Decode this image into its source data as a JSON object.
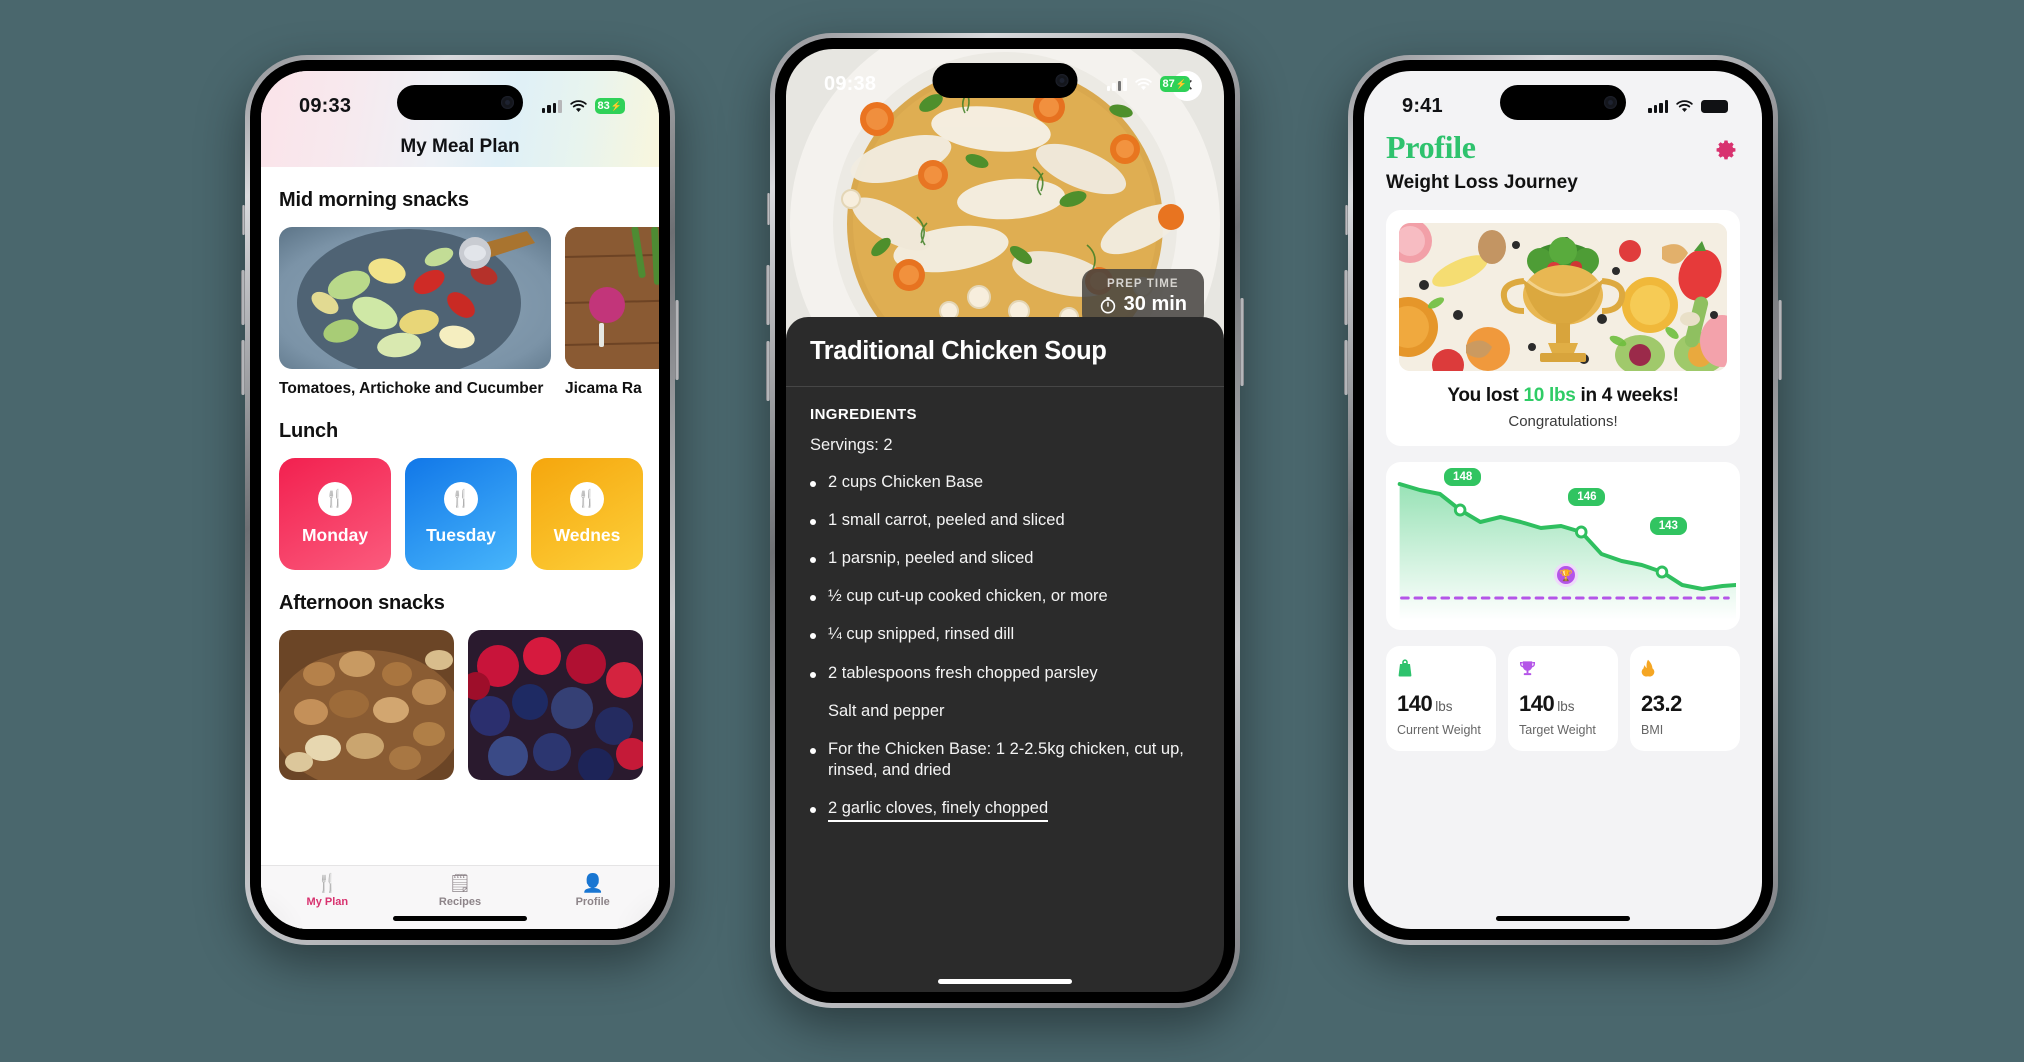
{
  "phone_meal_plan": {
    "status": {
      "time": "09:33",
      "battery_level": "83",
      "battery_charging": true,
      "signal_icon": "cellular-bars-icon",
      "wifi_icon": "wifi-icon"
    },
    "header": {
      "title": "My Meal Plan"
    },
    "sections": [
      {
        "title": "Mid morning snacks",
        "type": "snacks",
        "items": [
          {
            "label": "Tomatoes, Artichoke and Cucumber",
            "image": "cucumber-artichoke-salad-photo"
          },
          {
            "label": "Jicama Ra",
            "image": "jicama-radish-salad-photo"
          }
        ]
      },
      {
        "title": "Lunch",
        "type": "days",
        "items": [
          {
            "label": "Monday",
            "color": "#f4365e",
            "icon": "cutlery-icon"
          },
          {
            "label": "Tuesday",
            "color": "#1f8ef1",
            "icon": "cutlery-icon"
          },
          {
            "label": "Wednes",
            "color": "#f9b318",
            "icon": "cutlery-icon"
          }
        ]
      },
      {
        "title": "Afternoon snacks",
        "type": "snacks",
        "items": [
          {
            "label": "",
            "image": "mixed-nuts-photo"
          },
          {
            "label": "",
            "image": "mixed-berries-photo"
          }
        ]
      }
    ],
    "tabs": [
      {
        "label": "My Plan",
        "icon": "cutlery-icon",
        "active": true
      },
      {
        "label": "Recipes",
        "icon": "recipe-list-icon",
        "active": false
      },
      {
        "label": "Profile",
        "icon": "person-icon",
        "active": false
      }
    ],
    "active_tab_color": "#d8326f",
    "inactive_tab_color": "#9a9198"
  },
  "phone_recipe": {
    "status": {
      "time": "09:38",
      "battery_level": "87",
      "battery_charging": true,
      "signal_icon": "cellular-bars-icon",
      "wifi_icon": "wifi-icon"
    },
    "hero": {
      "image": "chicken-soup-bowl-photo",
      "close_icon": "close-icon"
    },
    "prep": {
      "label": "PREP TIME",
      "value": "30 min",
      "icon": "stopwatch-icon"
    },
    "recipe_title": "Traditional Chicken Soup",
    "ingredients_heading": "INGREDIENTS",
    "servings": "Servings: 2",
    "ingredients": [
      {
        "text": "2 cups Chicken Base",
        "bullet": true,
        "underline": false
      },
      {
        "text": "1 small carrot, peeled and sliced",
        "bullet": true,
        "underline": false
      },
      {
        "text": "1 parsnip, peeled and sliced",
        "bullet": true,
        "underline": false
      },
      {
        "text": "½ cup cut-up cooked chicken, or more",
        "bullet": true,
        "underline": false
      },
      {
        "text": "¼ cup snipped, rinsed dill",
        "bullet": true,
        "underline": false
      },
      {
        "text": "2 tablespoons fresh chopped parsley",
        "bullet": true,
        "underline": false
      },
      {
        "text": "Salt and pepper",
        "bullet": false,
        "underline": false
      },
      {
        "text": "For the Chicken Base: 1 2-2.5kg chicken, cut up, rinsed, and dried",
        "bullet": true,
        "underline": false
      },
      {
        "text": "2 garlic cloves, finely chopped",
        "bullet": true,
        "underline": true
      }
    ]
  },
  "phone_profile": {
    "status": {
      "time": "9:41",
      "battery_level": "",
      "battery_charging": false,
      "signal_icon": "cellular-bars-icon",
      "wifi_icon": "wifi-icon"
    },
    "gear_icon": "gear-icon",
    "title": "Profile",
    "title_color": "#2ec26d",
    "subtitle": "Weight Loss Journey",
    "achievement": {
      "image": "trophy-with-salad-and-fruits-photo",
      "headline_prefix": "You lost ",
      "headline_highlight": "10 lbs",
      "headline_suffix": " in 4 weeks!",
      "highlight_color": "#2fcc66",
      "congrats": "Congratulations!"
    },
    "stats": [
      {
        "icon": "weight-scale-icon",
        "icon_color": "#2ec26d",
        "value": "140",
        "unit": "lbs",
        "label": "Current Weight"
      },
      {
        "icon": "trophy-icon",
        "icon_color": "#b455e8",
        "value": "140",
        "unit": "lbs",
        "label": "Target Weight"
      },
      {
        "icon": "flame-icon",
        "icon_color": "#f5a623",
        "value": "23.2",
        "unit": "",
        "label": "BMI"
      }
    ],
    "chart_data": {
      "type": "area",
      "title": "",
      "xlabel": "",
      "ylabel": "",
      "line_color": "#2fbf5f",
      "fill_color": "#b9e9cc",
      "goal_line_color": "#b455e8",
      "goal_marker_icon": "trophy-icon",
      "grid": false,
      "legend": "none",
      "ylim": [
        138,
        151
      ],
      "x": [
        0,
        1,
        2,
        3,
        4,
        5,
        6,
        7,
        8,
        9,
        10,
        11,
        12,
        13,
        14,
        15,
        16,
        17
      ],
      "values": [
        150,
        149.6,
        148.9,
        148.0,
        146.9,
        147.1,
        146.9,
        146.3,
        146.4,
        146.0,
        144.6,
        143.9,
        143.6,
        143.0,
        141.9,
        141.0,
        141.2,
        141.3
      ],
      "goal_value": 140,
      "point_labels": [
        {
          "x": 3,
          "value": "148"
        },
        {
          "x": 9,
          "value": "146"
        },
        {
          "x": 13,
          "value": "143"
        }
      ]
    }
  }
}
